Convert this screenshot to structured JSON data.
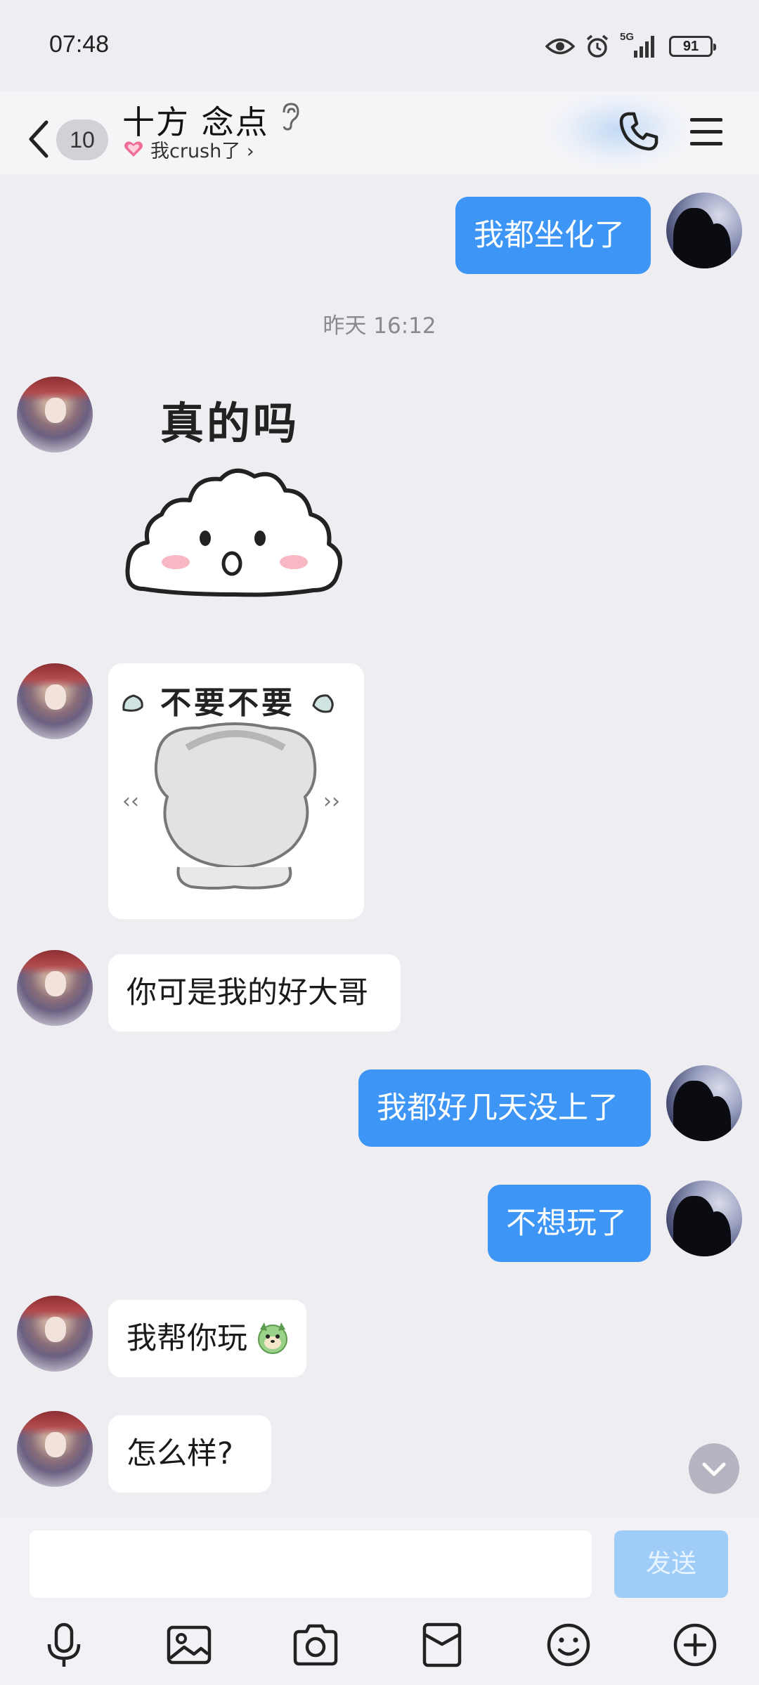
{
  "status_bar": {
    "time": "07:48",
    "network_label": "5G",
    "battery": "91"
  },
  "header": {
    "unread_count": "10",
    "title": "十方  念点",
    "subtitle": "我crush了 ›"
  },
  "messages": {
    "m1": {
      "sender": "self",
      "text": "我都坐化了"
    },
    "timestamp": "昨天 16:12",
    "sticker1": {
      "sender": "other",
      "caption": "真的吗"
    },
    "sticker2": {
      "sender": "other",
      "caption": "不要不要"
    },
    "m2": {
      "sender": "other",
      "text": "你可是我的好大哥"
    },
    "m3": {
      "sender": "self",
      "text": "我都好几天没上了"
    },
    "m4": {
      "sender": "self",
      "text": "不想玩了"
    },
    "m5": {
      "sender": "other",
      "text": "我帮你玩"
    },
    "m6": {
      "sender": "other",
      "text": "怎么样?"
    }
  },
  "input": {
    "value": "",
    "send_label": "发送"
  },
  "toolbar": {
    "items": [
      "microphone-icon",
      "image-icon",
      "camera-icon",
      "red-packet-icon",
      "emoji-icon",
      "add-icon"
    ]
  },
  "colors": {
    "self_bubble": "#3d95f5",
    "other_bubble": "#ffffff",
    "background": "#eeedf2",
    "send_button": "#9fcdf8"
  }
}
